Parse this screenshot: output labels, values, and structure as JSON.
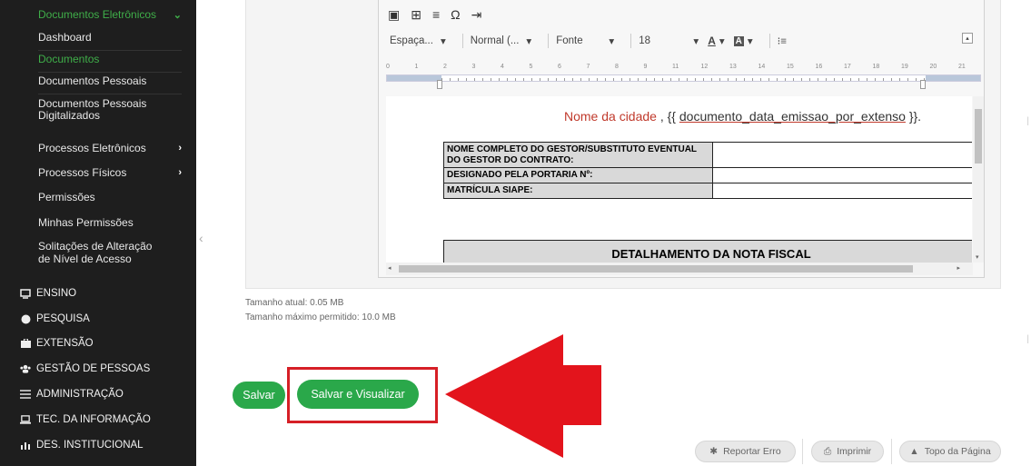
{
  "sidebar": {
    "submenu_header": "Documentos Eletrônicos",
    "submenu_items": [
      "Dashboard",
      "Documentos",
      "Documentos Pessoais",
      "Documentos Pessoais Digitalizados"
    ],
    "groups": [
      "Processos Eletrônicos",
      "Processos Físicos",
      "Permissões",
      "Minhas Permissões",
      "Solitações de Alteração de Nível de Acesso"
    ],
    "modules": [
      "ENSINO",
      "PESQUISA",
      "EXTENSÃO",
      "GESTÃO DE PESSOAS",
      "ADMINISTRAÇÃO",
      "TEC. DA INFORMAÇÃO",
      "DES. INSTITUCIONAL"
    ],
    "active_color": "#3fae49"
  },
  "editor": {
    "toolbar": {
      "spacing": "Espaça...",
      "style": "Normal (...",
      "font": "Fonte",
      "size": "18"
    },
    "ruler_numbers": [
      "0",
      "1",
      "2",
      "3",
      "4",
      "5",
      "6",
      "7",
      "8",
      "9",
      "11",
      "12",
      "13",
      "14",
      "15",
      "16",
      "17",
      "18",
      "19",
      "20",
      "21"
    ],
    "doc": {
      "city": "Nome da cidade",
      "separator": " , {{ ",
      "placeholder": "documento_data_emissao_por_extenso",
      "suffix": " }}.",
      "table_rows": [
        "NOME COMPLETO DO GESTOR/SUBSTITUTO EVENTUAL DO GESTOR DO CONTRATO:",
        "DESIGNADO PELA PORTARIA Nº:",
        "MATRÍCULA SIAPE:"
      ],
      "section_title": "DETALHAMENTO DA NOTA FISCAL"
    }
  },
  "file_info": {
    "current": "Tamanho atual: 0.05 MB",
    "max": "Tamanho máximo permitido: 10.0 MB"
  },
  "actions": {
    "save": "Salvar",
    "save_view": "Salvar e Visualizar"
  },
  "footer": {
    "report": "Reportar Erro",
    "print": "Imprimir",
    "top": "Topo da Página"
  },
  "colors": {
    "primary_green": "#2aa84a",
    "highlight_red": "#d61f26"
  }
}
